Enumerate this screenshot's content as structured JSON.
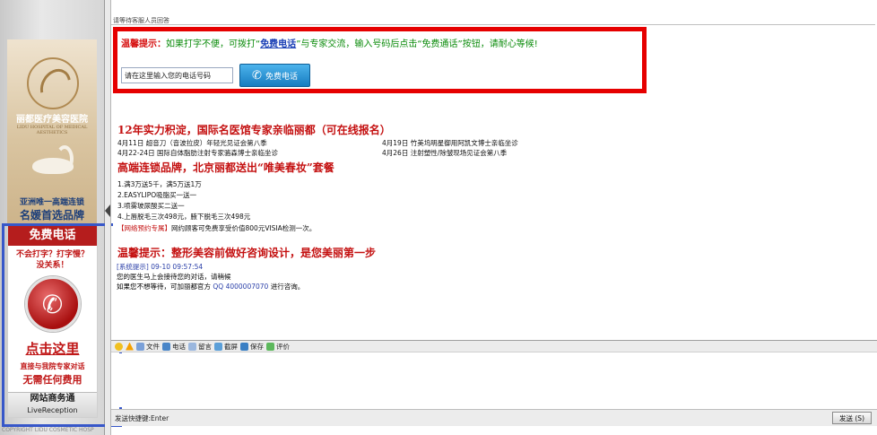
{
  "sidebar": {
    "brand_name": "丽都医疗美容医院",
    "brand_en": "LIDU HOSPITAL OF MEDICAL AESTHETICS",
    "slogan_1": "亚洲唯一高端连锁",
    "slogan_2": "名媛首选品牌",
    "call_title": "免费电话",
    "call_sub_1": "不会打字？打字慢？",
    "call_sub_2": "没关系！",
    "click_here": "点击这里",
    "call_sub_3": "直接与我院专家对话",
    "call_sub_4": "无需任何费用",
    "footer_title": "网站商务通",
    "footer_sub": "LiveReception",
    "copyright": "COPYRIGHT LIDU COSMETIC HOSP"
  },
  "header": {
    "status_text": "请等待客服人员回答"
  },
  "notice": {
    "label": "温馨提示：",
    "text_before_link": "如果打字不便，可拨打“",
    "link_text": "免费电话",
    "text_after_link": "”与专家交流，输入号码后点击“免费通话”按钮，请耐心等候!",
    "phone_input_value": "请在这里输入您的电话号码",
    "call_button_label": "免费电话"
  },
  "chat": {
    "heading_1": "12年实力积淀，国际名医馆专家亲临丽都（可在线报名）",
    "events": [
      {
        "left": "4月11日 超音刀（音波拉皮）年轻光见证会第八季",
        "right": "4月19日 竹美坞明星御用阿凯文博士亲临坐诊"
      },
      {
        "left": "4月22-24日 国际自体脂肪注射专家骆森博士亲临坐诊",
        "right": "4月26日 注射塑性/除皱现场见证会第八季"
      }
    ],
    "heading_2": "高端连锁品牌，北京丽都送出“唯美春妆”套餐",
    "offers": [
      "1.满3万送5千，满5万送1万",
      "2.EASYLIPO吸脂买一送一",
      "3.喷雾玻尿酸买二送一",
      "4.上唇脱毛三次498元，腋下脱毛三次498元"
    ],
    "online_label": "【网络预约专属】",
    "online_text": "网约顾客可免费享受价值800元VISIA检测一次。",
    "heading_3": "温馨提示：整形美容前做好咨询设计，是您美丽第一步",
    "sys_label": "[系统提示]",
    "sys_time": "09-10 09:57:54",
    "sys_line_1": "您的医生马上会接待您的对话，请稍候",
    "sys_line_2_before": "如果您不想等待，可加丽都官方",
    "sys_qq": "QQ 4000007070",
    "sys_line_2_after": "进行咨询。"
  },
  "toolbar": {
    "items": [
      "文件",
      "电话",
      "留言",
      "截屏",
      "保存",
      "评价"
    ]
  },
  "statusbar": {
    "hint": "发送快捷键:Enter",
    "send_label": "发送 (S)"
  },
  "colors": {
    "red": "#c41010",
    "notice_frame": "#e60000",
    "sidebar_frame": "#3757c9",
    "call_button": "#177cc0",
    "green_text": "#0a8b0a"
  }
}
